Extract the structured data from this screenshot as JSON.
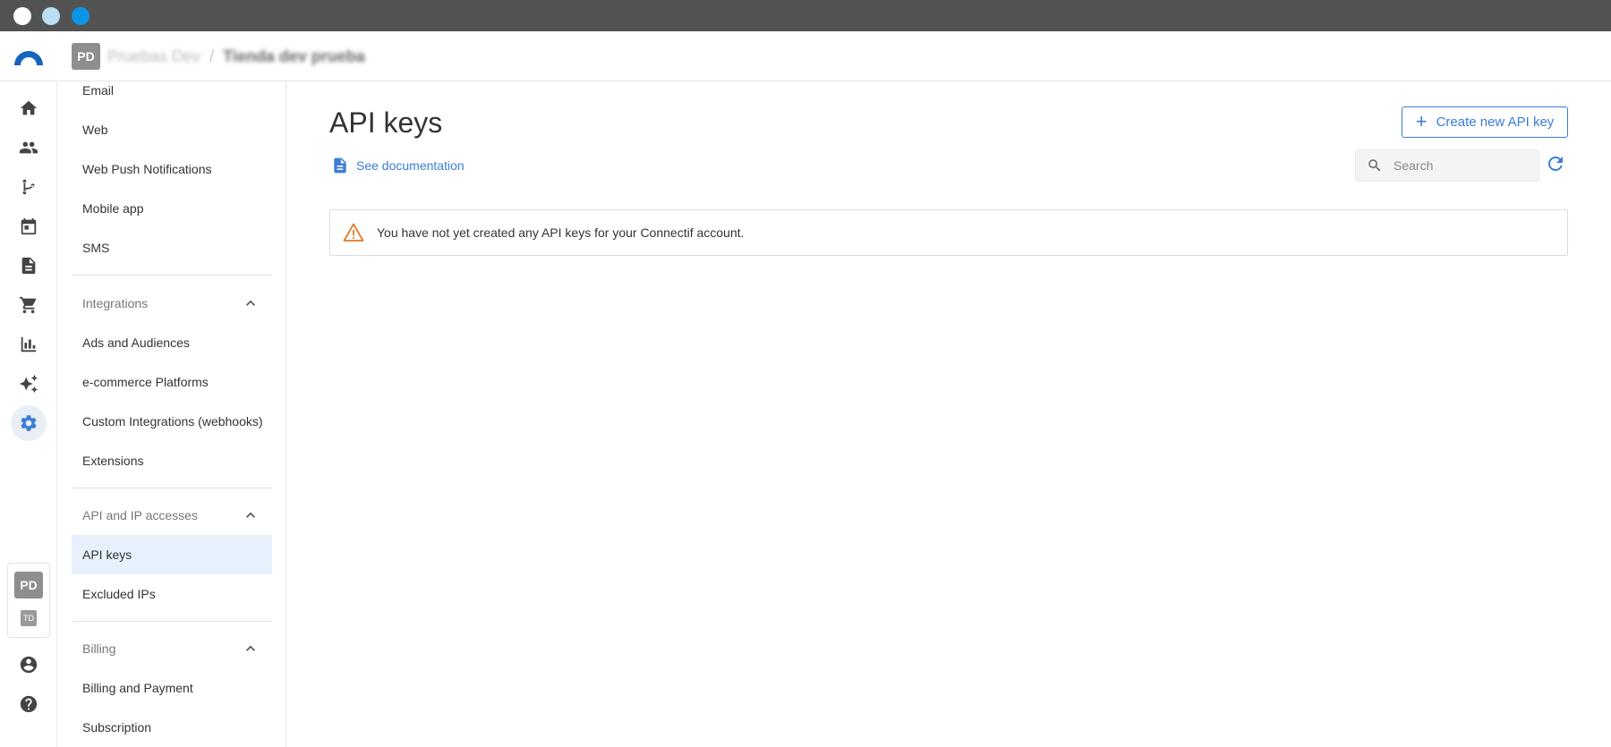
{
  "header": {
    "workspace_initials": "PD",
    "breadcrumb_parent": "Pruebas Dev",
    "breadcrumb_separator": "/",
    "breadcrumb_current": "Tienda dev prueba"
  },
  "rail": {
    "icons": [
      "home-icon",
      "contacts-icon",
      "workflows-icon",
      "calendar-icon",
      "content-icon",
      "store-icon",
      "reports-icon",
      "ai-icon",
      "settings-icon"
    ],
    "account_primary": "PD",
    "account_secondary": "TD",
    "active_color": "#3b7dd8"
  },
  "nav": {
    "items": [
      {
        "label": "Email"
      },
      {
        "label": "Web"
      },
      {
        "label": "Web Push Notifications"
      },
      {
        "label": "Mobile app"
      },
      {
        "label": "SMS"
      }
    ],
    "integrations": {
      "title": "Integrations",
      "items": [
        {
          "label": "Ads and Audiences"
        },
        {
          "label": "e-commerce Platforms"
        },
        {
          "label": "Custom Integrations (webhooks)"
        },
        {
          "label": "Extensions"
        }
      ]
    },
    "api": {
      "title": "API and IP accesses",
      "items": [
        {
          "label": "API keys",
          "selected": true
        },
        {
          "label": "Excluded IPs"
        }
      ]
    },
    "billing": {
      "title": "Billing",
      "items": [
        {
          "label": "Billing and Payment"
        },
        {
          "label": "Subscription"
        }
      ]
    }
  },
  "main": {
    "title": "API keys",
    "doc_link": "See documentation",
    "create_button": "Create new API key",
    "search_placeholder": "Search",
    "empty_message": "You have not yet created any API keys for your Connectif account.",
    "warning_color": "#e07b28"
  }
}
